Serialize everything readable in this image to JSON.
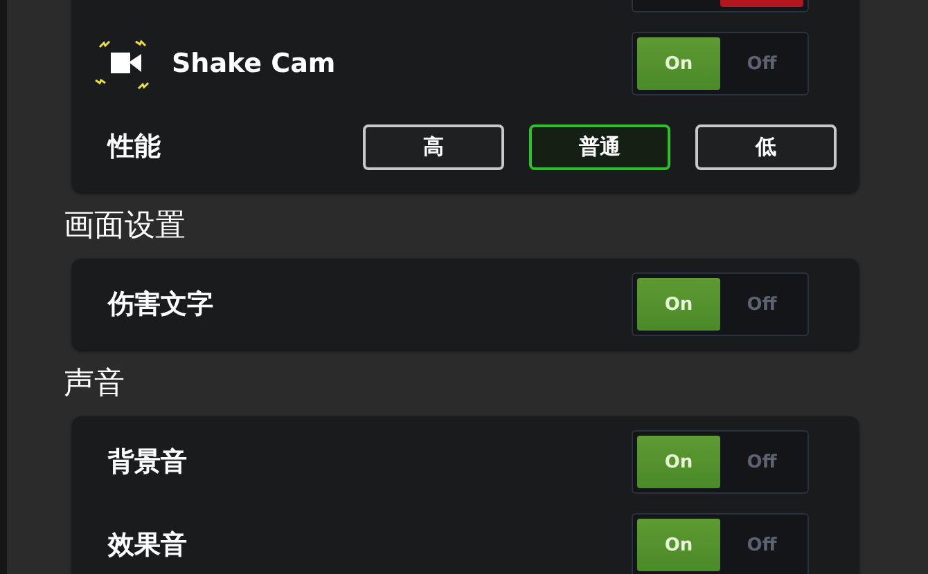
{
  "sections": [
    {
      "rows": [
        {
          "kind": "toggle",
          "on": false
        },
        {
          "kind": "toggle",
          "icon": true,
          "label": "Shake Cam",
          "on": true,
          "on_text": "On",
          "off_text": "Off"
        },
        {
          "kind": "choice",
          "label": "性能",
          "options": [
            {
              "label": "高",
              "selected": false
            },
            {
              "label": "普通",
              "selected": true
            },
            {
              "label": "低",
              "selected": false
            }
          ]
        }
      ]
    },
    {
      "title": "画面设置",
      "rows": [
        {
          "kind": "toggle",
          "label": "伤害文字",
          "on": true,
          "on_text": "On",
          "off_text": "Off"
        }
      ]
    },
    {
      "title": "声音",
      "rows": [
        {
          "kind": "toggle",
          "label": "背景音",
          "on": true,
          "on_text": "On",
          "off_text": "Off"
        },
        {
          "kind": "toggle",
          "label": "效果音",
          "on": true,
          "on_text": "On",
          "off_text": "Off"
        }
      ]
    }
  ]
}
